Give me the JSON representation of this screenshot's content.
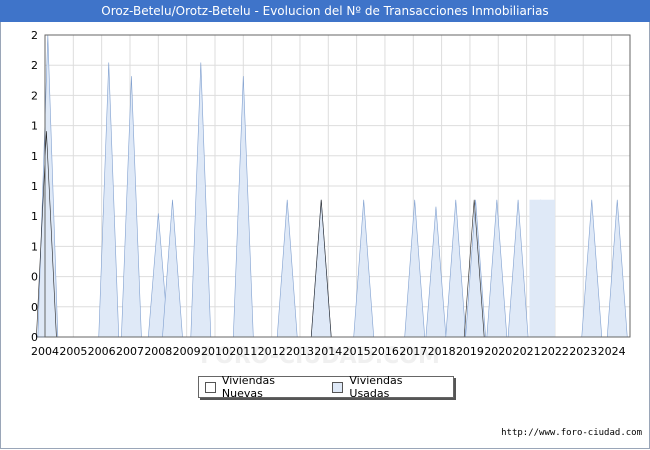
{
  "chart_data": {
    "type": "area",
    "title": "Oroz-Betelu/Orotz-Betelu - Evolucion del Nº de Transacciones Inmobiliarias",
    "xlabel": "",
    "ylabel": "",
    "ylim": [
      0,
      2.2
    ],
    "y_tick_labels": [
      "0",
      "0",
      "0",
      "1",
      "1",
      "1",
      "1",
      "1",
      "2",
      "2",
      "2"
    ],
    "x_tick_labels": [
      "2004",
      "2005",
      "2006",
      "2007",
      "2008",
      "2009",
      "2010",
      "2011",
      "2012",
      "2013",
      "2014",
      "2015",
      "2016",
      "2017",
      "2018",
      "2019",
      "2020",
      "2021",
      "2022",
      "2023",
      "2024"
    ],
    "grid": true,
    "legend_position": "bottom",
    "series": [
      {
        "name": "Viviendas Nuevas",
        "color": "#ffffff",
        "points": [
          [
            2004.05,
            1.5
          ],
          [
            2013.75,
            1.0
          ],
          [
            2019.15,
            1.0
          ]
        ]
      },
      {
        "name": "Viviendas Usadas",
        "color": "#dfe9f7",
        "points": [
          [
            2004.1,
            2.2
          ],
          [
            2006.25,
            2.0
          ],
          [
            2007.05,
            1.9
          ],
          [
            2008.0,
            0.9
          ],
          [
            2008.5,
            1.0
          ],
          [
            2009.5,
            2.0
          ],
          [
            2011.0,
            1.9
          ],
          [
            2012.55,
            1.0
          ],
          [
            2013.75,
            1.0
          ],
          [
            2015.25,
            1.0
          ],
          [
            2017.05,
            1.0
          ],
          [
            2017.8,
            0.95
          ],
          [
            2018.5,
            1.0
          ],
          [
            2019.2,
            1.0
          ],
          [
            2019.95,
            1.0
          ],
          [
            2020.7,
            1.0
          ],
          [
            2021.5,
            1.0
          ],
          [
            2023.3,
            1.0
          ],
          [
            2024.2,
            1.0
          ]
        ]
      }
    ]
  },
  "watermark": "FORO-CIUDAD.COM",
  "footer_url": "http://www.foro-ciudad.com"
}
